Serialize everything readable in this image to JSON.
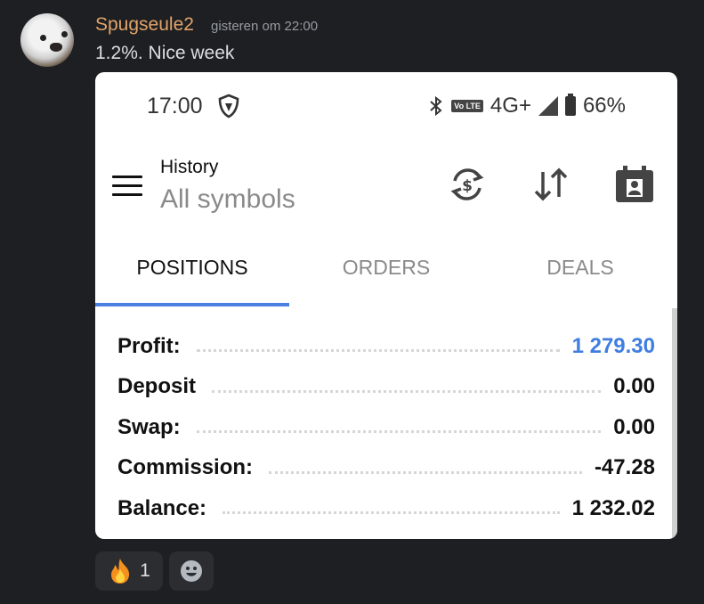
{
  "message": {
    "author": "Spugseule2",
    "timestamp": "gisteren om 22:00",
    "text": "1.2%. Nice week"
  },
  "screenshot": {
    "status_bar": {
      "time": "17:00",
      "network": "4G+",
      "volte": "Vo LTE",
      "battery": "66%"
    },
    "toolbar": {
      "title": "History",
      "subtitle": "All symbols",
      "icons": [
        "menu-icon",
        "currency-exchange-icon",
        "sort-icon",
        "calendar-icon"
      ]
    },
    "tabs": [
      {
        "label": "POSITIONS",
        "active": true
      },
      {
        "label": "ORDERS",
        "active": false
      },
      {
        "label": "DEALS",
        "active": false
      }
    ],
    "summary": [
      {
        "label": "Profit:",
        "value": "1 279.30",
        "highlight": "#3f7ee0"
      },
      {
        "label": "Deposit",
        "value": "0.00"
      },
      {
        "label": "Swap:",
        "value": "0.00"
      },
      {
        "label": "Commission:",
        "value": "-47.28"
      },
      {
        "label": "Balance:",
        "value": "1 232.02"
      }
    ]
  },
  "reactions": [
    {
      "icon": "fire-icon",
      "count": "1"
    },
    {
      "icon": "add-reaction-icon",
      "count": ""
    }
  ],
  "colors": {
    "background": "#1e1f22",
    "author": "#e0a46b",
    "accent": "#4a80e0"
  }
}
